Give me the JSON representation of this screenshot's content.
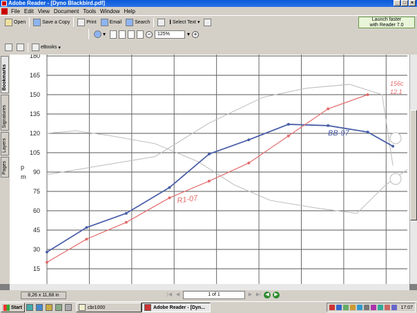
{
  "window": {
    "title": "Adobe Reader - [Dyno Blackbird.pdf]",
    "buttons": [
      "_",
      "□",
      "×"
    ]
  },
  "menu": [
    "File",
    "Edit",
    "View",
    "Document",
    "Tools",
    "Window",
    "Help"
  ],
  "toolbar": {
    "open": "Open",
    "save_copy": "Save a Copy",
    "print": "Print",
    "email": "Email",
    "search": "Search",
    "select_text": "Select Text",
    "launch_line1": "Launch faster",
    "launch_line2": "with Reader 7.0",
    "zoom_value": "125%",
    "ebooks": "eBooks"
  },
  "nav_tabs": [
    "Bookmarks",
    "Signatures",
    "Layers",
    "Pages"
  ],
  "document": {
    "y_ticks": [
      "180",
      "165",
      "150",
      "135",
      "120",
      "105",
      "90",
      "75",
      "60",
      "45",
      "30",
      "15"
    ],
    "axis_mark_p": "p",
    "axis_mark_m": "m",
    "annot_r1": "R1-07",
    "annot_bb": "BB-97",
    "annot_right1": "156c",
    "annot_right2": "12.1"
  },
  "chart_data": {
    "type": "line",
    "y_ticks": [
      180,
      165,
      150,
      135,
      120,
      105,
      90,
      75,
      60,
      45,
      30,
      15
    ],
    "series": [
      {
        "name": "BB-97",
        "color": "#4a5fa8",
        "points": [
          [
            0.0,
            28
          ],
          [
            0.11,
            47
          ],
          [
            0.22,
            58
          ],
          [
            0.34,
            78
          ],
          [
            0.45,
            104
          ],
          [
            0.56,
            115
          ],
          [
            0.67,
            127
          ],
          [
            0.78,
            126
          ],
          [
            0.89,
            121
          ],
          [
            0.96,
            110
          ]
        ]
      },
      {
        "name": "R1-07",
        "color": "#e36a6a",
        "points": [
          [
            0.0,
            20
          ],
          [
            0.11,
            38
          ],
          [
            0.22,
            51
          ],
          [
            0.34,
            70
          ],
          [
            0.45,
            83
          ],
          [
            0.56,
            97
          ],
          [
            0.67,
            118
          ],
          [
            0.78,
            139
          ],
          [
            0.89,
            150
          ]
        ]
      }
    ]
  },
  "status": {
    "page_size": "8,26 x 11,68 in",
    "page_indicator": "1 of 1"
  },
  "taskbar": {
    "start": "Start",
    "tasks": [
      "cbr1000",
      "Adobe Reader - [Dyn..."
    ],
    "clock": "17:07"
  }
}
